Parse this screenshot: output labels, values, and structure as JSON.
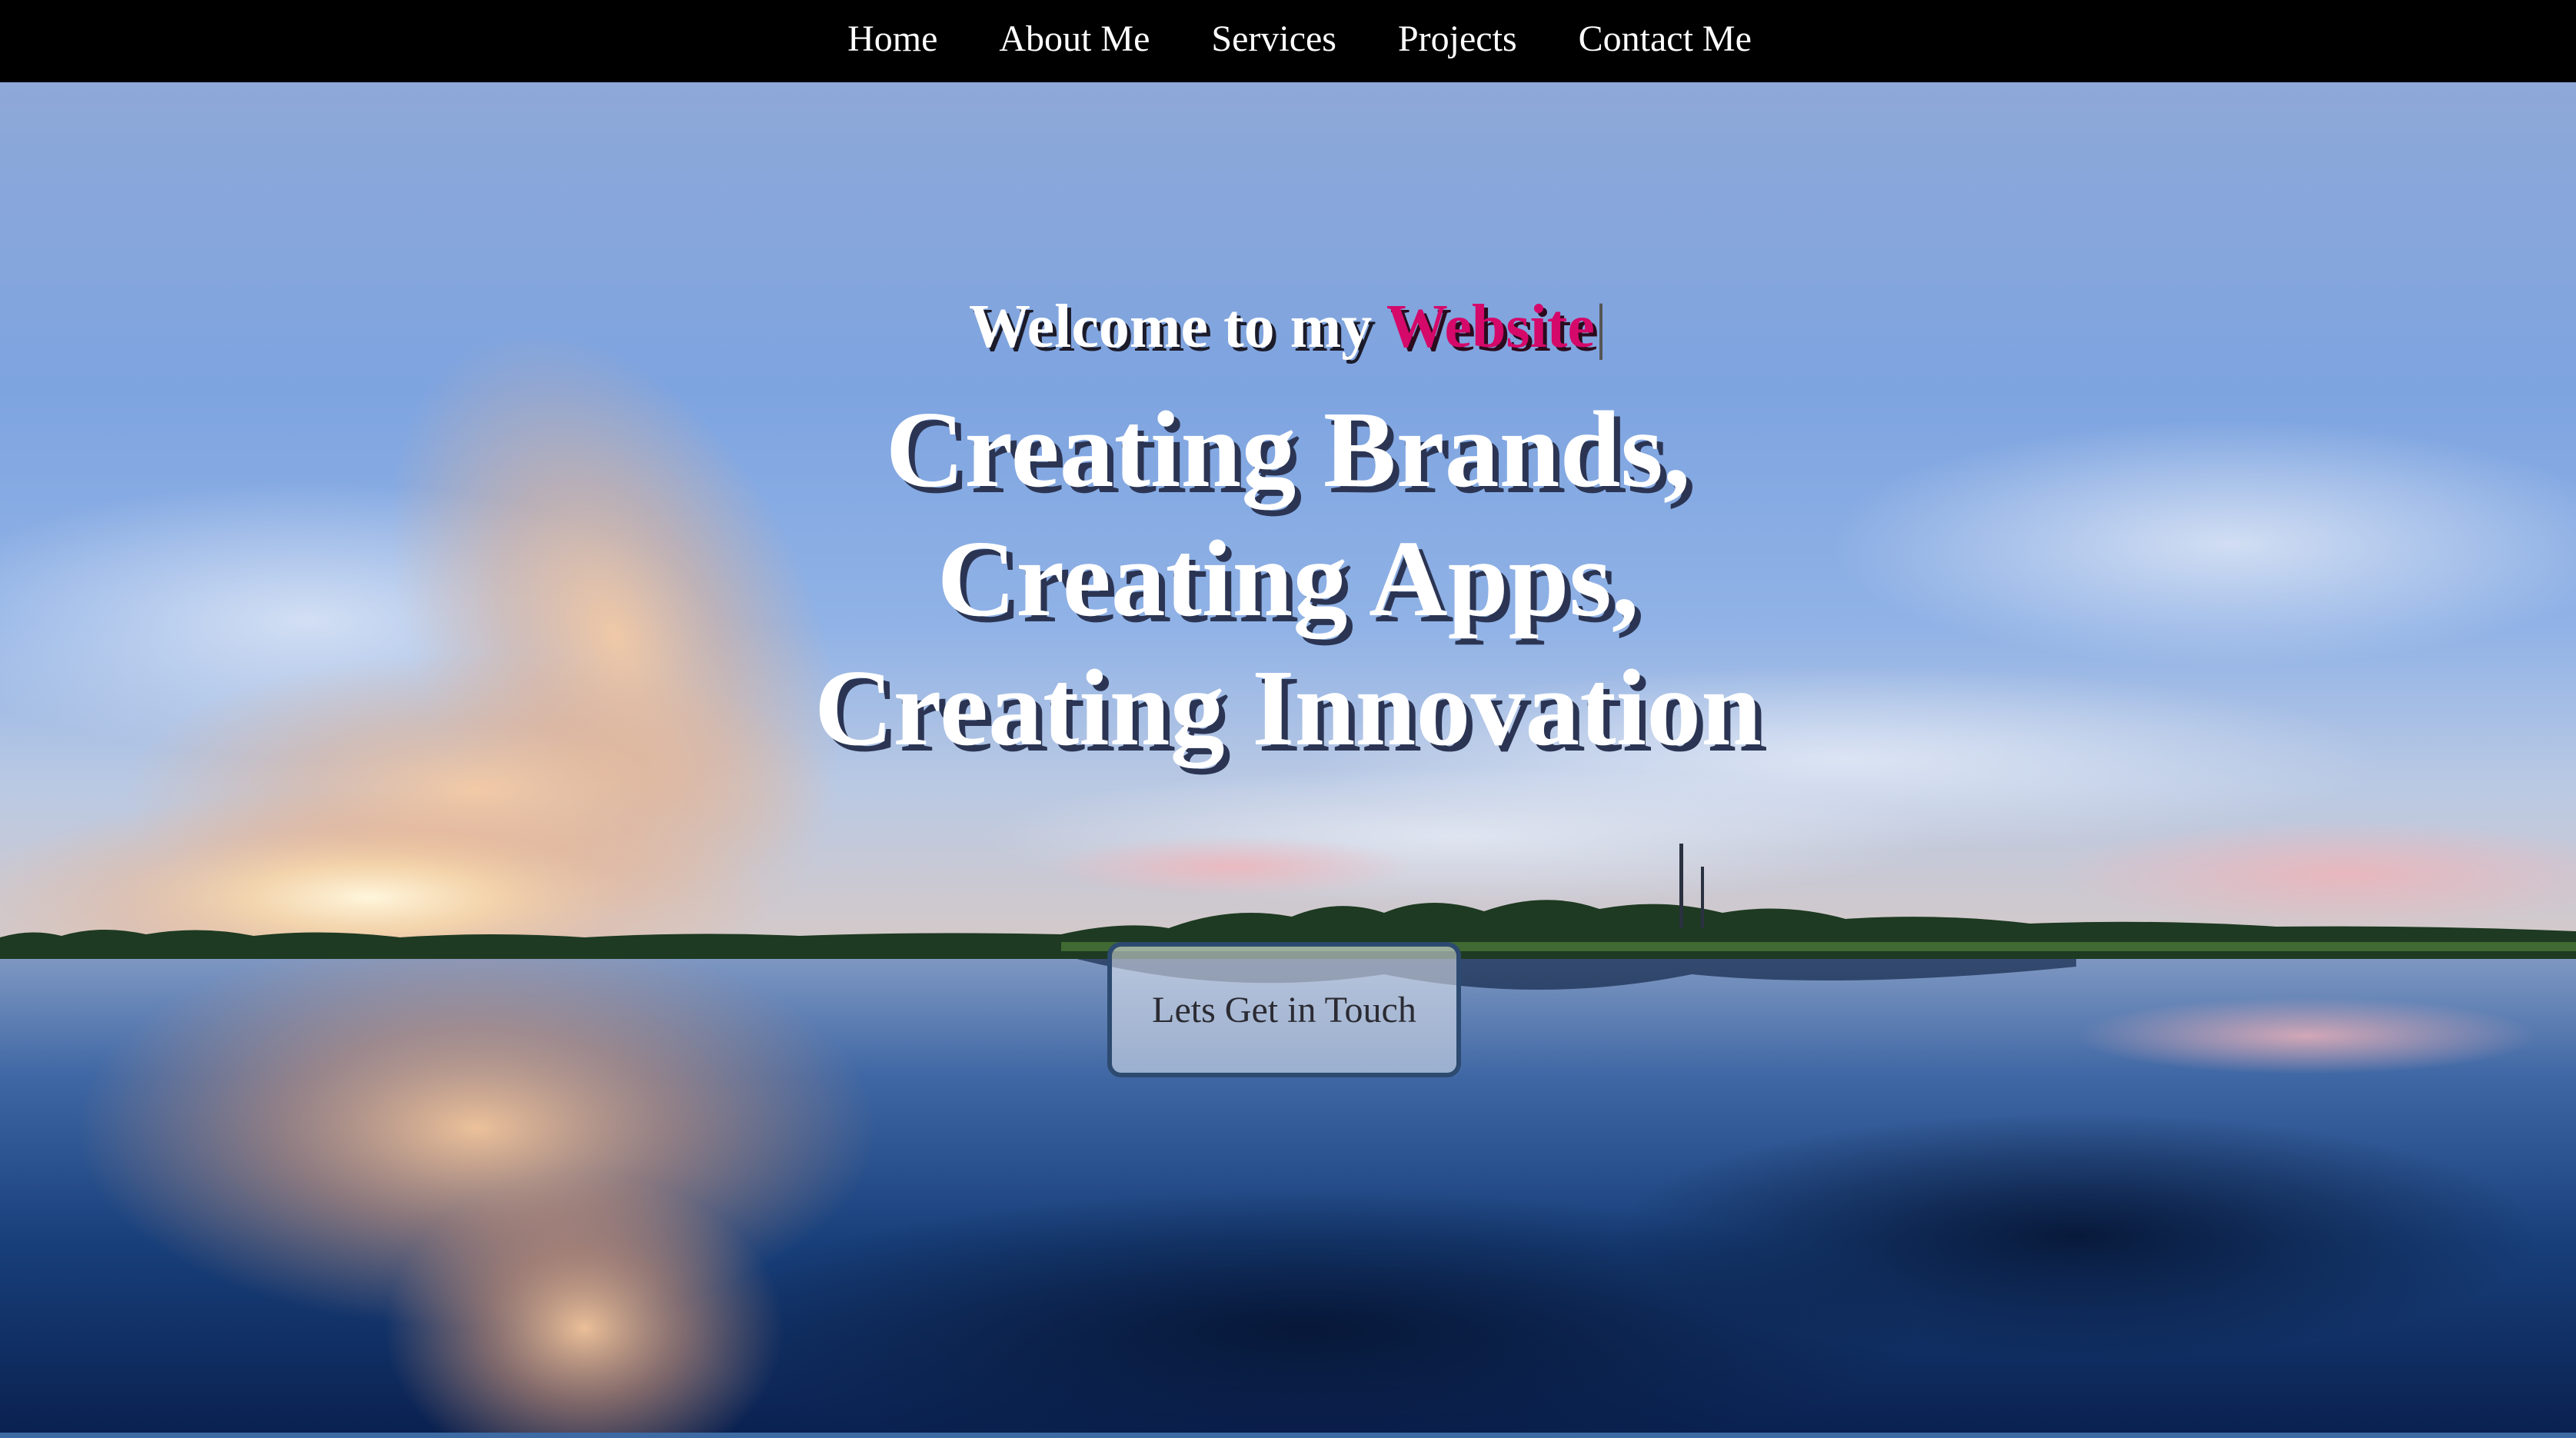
{
  "nav": {
    "items": [
      {
        "label": "Home"
      },
      {
        "label": "About Me"
      },
      {
        "label": "Services"
      },
      {
        "label": "Projects"
      },
      {
        "label": "Contact Me"
      }
    ]
  },
  "hero": {
    "welcome_prefix": "Welcome to my ",
    "welcome_accent": "Website",
    "typing_cursor": "|",
    "headline_lines": [
      "Creating Brands,",
      "Creating Apps,",
      "Creating Innovation"
    ],
    "cta_label": "Lets Get in Touch"
  },
  "colors": {
    "navbar_bg": "#000000",
    "nav_text": "#ffffff",
    "accent": "#d4096a",
    "headline_text": "#ffffff",
    "sky_top": "#8fa9d9",
    "water_dark": "#0c2a58"
  },
  "background": {
    "description_icon": "lake-sunset-panorama-image"
  }
}
